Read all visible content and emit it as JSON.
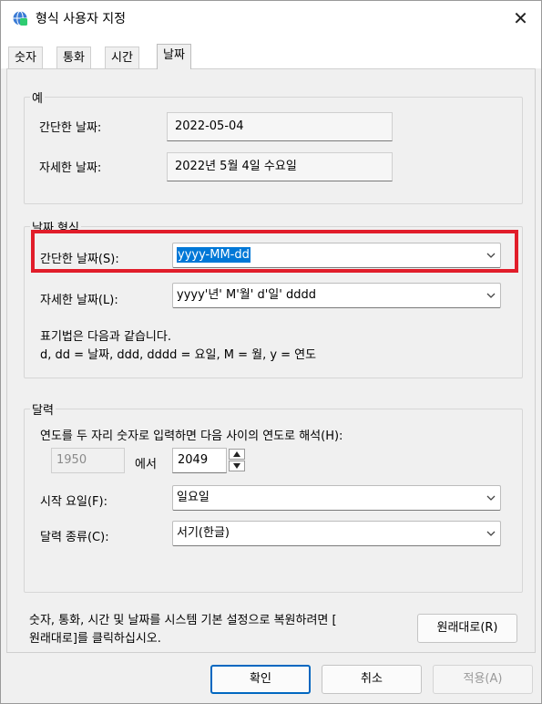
{
  "window": {
    "title": "형식 사용자 지정",
    "app_icon": "settings-globe-icon",
    "close_glyph": "✕"
  },
  "tabs": [
    {
      "label": "숫자"
    },
    {
      "label": "통화"
    },
    {
      "label": "시간"
    },
    {
      "label": "날짜"
    }
  ],
  "example": {
    "legend": "예",
    "short_label": "간단한 날짜:",
    "short_value": "2022-05-04",
    "long_label": "자세한 날짜:",
    "long_value": "2022년 5월 4일 수요일"
  },
  "date_format": {
    "legend": "날짜 형식",
    "short_label": "간단한 날짜(S):",
    "short_value": "yyyy-MM-dd",
    "long_label": "자세한 날짜(L):",
    "long_value": "yyyy'년' M'월' d'일' dddd",
    "notation_line1": "표기법은 다음과 같습니다.",
    "notation_line2": "d, dd = 날짜,  ddd, dddd = 요일,  M = 월,  y = 연도"
  },
  "calendar": {
    "legend": "달력",
    "two_digit_label": "연도를 두 자리 숫자로 입력하면 다음 사이의 연도로 해석(H):",
    "start_year": "1950",
    "between_text": "에서",
    "end_year": "2049",
    "first_day_label": "시작 요일(F):",
    "first_day_value": "일요일",
    "calendar_type_label": "달력 종류(C):",
    "calendar_type_value": "서기(한글)"
  },
  "reset": {
    "text_line1": "숫자, 통화, 시간 및 날짜를 시스템 기본 설정으로 복원하려면 [",
    "text_line2": "원래대로]를 클릭하십시오.",
    "button_label": "원래대로(R)"
  },
  "buttons": {
    "ok": "확인",
    "cancel": "취소",
    "apply": "적용(A)"
  },
  "colors": {
    "selection": "#0078d7",
    "highlight_border": "#e11d2a",
    "primary_border": "#0067c0"
  }
}
